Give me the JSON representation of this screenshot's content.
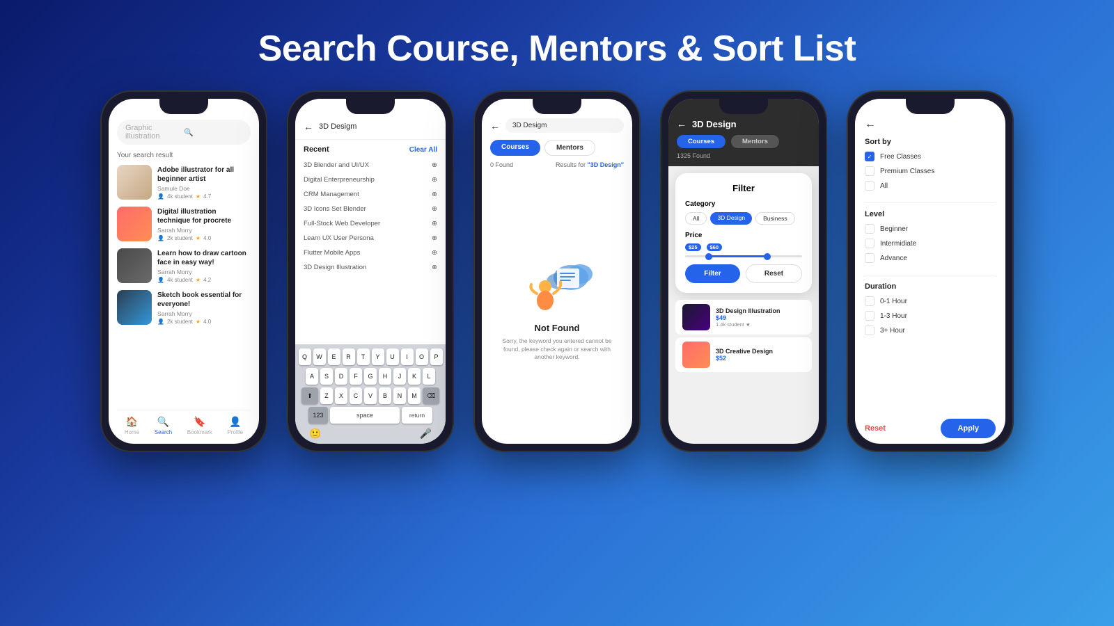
{
  "page": {
    "title": "Search Course, Mentors & Sort List",
    "bg_gradient": "linear-gradient(135deg, #0a1a6b 0%, #1a3a9f 30%, #2a6fd4 60%, #3a9fe8 100%)"
  },
  "phone1": {
    "search_placeholder": "Graphic illustration",
    "result_label": "Your search result",
    "courses": [
      {
        "title": "Adobe illustrator for all beginner artist",
        "author": "Samule Doe",
        "students": "4k student",
        "rating": "4.7",
        "thumb_class": "thumb-1"
      },
      {
        "title": "Digital illustration technique for procrete",
        "author": "Sarrah Morry",
        "students": "2k student",
        "rating": "4.0",
        "thumb_class": "thumb-2"
      },
      {
        "title": "Learn how to draw cartoon face in easy way!",
        "author": "Sarrah Morry",
        "students": "4k student",
        "rating": "4.2",
        "thumb_class": "thumb-3"
      },
      {
        "title": "Sketch book essential for everyone!",
        "author": "Sarrah Morry",
        "students": "2k student",
        "rating": "4.0",
        "thumb_class": "thumb-4"
      }
    ],
    "nav": [
      {
        "label": "Home",
        "icon": "🏠",
        "active": false
      },
      {
        "label": "Search",
        "icon": "🔍",
        "active": true
      },
      {
        "label": "Bookmark",
        "icon": "🔖",
        "active": false
      },
      {
        "label": "Profile",
        "icon": "👤",
        "active": false
      }
    ]
  },
  "phone2": {
    "search_text": "3D Desigm",
    "recent_label": "Recent",
    "clear_all": "Clear All",
    "recent_items": [
      "3D Blender and UI/UX",
      "Digital Enterpreneurship",
      "CRM Management",
      "3D Icons Set Blender",
      "Full-Stock Web Developer",
      "Learn UX User Persona",
      "Flutter Mobile Apps",
      "3D Design Illustration"
    ],
    "keyboard_rows": [
      [
        "Q",
        "W",
        "E",
        "R",
        "T",
        "Y",
        "U",
        "I",
        "O",
        "P"
      ],
      [
        "A",
        "S",
        "D",
        "F",
        "G",
        "H",
        "J",
        "K",
        "L"
      ],
      [
        "⬆",
        "Z",
        "X",
        "C",
        "V",
        "B",
        "N",
        "M",
        "⌫"
      ],
      [
        "123",
        "space",
        "return"
      ]
    ]
  },
  "phone3": {
    "search_text": "3D Desigm",
    "tabs": [
      "Courses",
      "Mentors"
    ],
    "active_tab": "Courses",
    "found_count": "0 Found",
    "results_for_label": "Results for",
    "search_query": "\"3D Design\"",
    "not_found_title": "Not Found",
    "not_found_desc": "Sorry, the keyword you entered cannot be found, please check again or search with another keyword."
  },
  "phone4": {
    "search_text": "3D Design",
    "tabs": [
      "Courses",
      "Mentors"
    ],
    "active_tab": "Courses",
    "found_count": "1325 Found",
    "filter": {
      "title": "Filter",
      "category_label": "Category",
      "categories": [
        "All",
        "3D Design",
        "Business"
      ],
      "active_category": "3D Design",
      "price_label": "Price",
      "price_min": "$25",
      "price_max": "$60",
      "filter_btn": "Filter",
      "reset_btn": "Reset"
    },
    "courses": [
      {
        "title": "3D Design Illustration",
        "price": "$49",
        "students": "1.4k student",
        "thumb_class": "cm-t1"
      },
      {
        "title": "3D Creative Design",
        "price": "$52",
        "thumb_class": "cm-t2"
      }
    ]
  },
  "phone5": {
    "sort_by_label": "Sort by",
    "sort_options": [
      {
        "label": "Free Classes",
        "checked": true
      },
      {
        "label": "Premium  Classes",
        "checked": false
      },
      {
        "label": "All",
        "checked": false
      }
    ],
    "level_label": "Level",
    "level_options": [
      {
        "label": "Beginner",
        "checked": false
      },
      {
        "label": "Intermidiate",
        "checked": false
      },
      {
        "label": "Advance",
        "checked": false
      }
    ],
    "duration_label": "Duration",
    "duration_options": [
      {
        "label": "0-1 Hour",
        "checked": false
      },
      {
        "label": "1-3 Hour",
        "checked": false
      },
      {
        "label": "3+ Hour",
        "checked": false
      }
    ],
    "reset_label": "Reset",
    "apply_label": "Apply"
  }
}
